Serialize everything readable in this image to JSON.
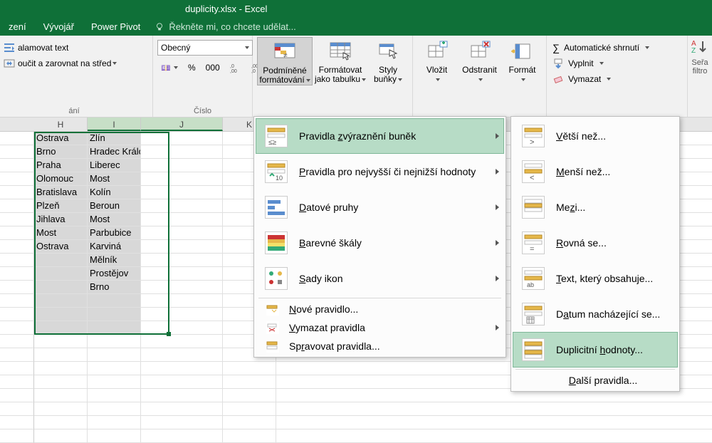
{
  "title": "duplicity.xlsx - Excel",
  "ribbon_tabs": [
    "zení",
    "Vývojář",
    "Power Pivot"
  ],
  "tell_me": "Řekněte mi, co chcete udělat...",
  "alignment": {
    "wrap": "alamovat text",
    "merge": "oučit a zarovnat na střed",
    "group_label": "ání"
  },
  "number": {
    "format": "Obecný",
    "group_label": "Číslo"
  },
  "styles": {
    "cond_fmt_line1": "Podmíněné",
    "cond_fmt_line2": "formátování",
    "fmt_table_line1": "Formátovat",
    "fmt_table_line2": "jako tabulku",
    "cell_styles_line1": "Styly",
    "cell_styles_line2": "buňky"
  },
  "cells_group": {
    "insert": "Vložit",
    "delete": "Odstranit",
    "format": "Formát"
  },
  "editing": {
    "autosum": "Automatické shrnutí",
    "fill": "Vyplnit",
    "clear": "Vymazat"
  },
  "sort_hint_line1": "Seřa",
  "sort_hint_line2": "filtro",
  "columns": [
    "H",
    "I",
    "J",
    "K"
  ],
  "sel_cols": [
    "I",
    "J"
  ],
  "grid": [
    [
      "Ostrava",
      "Zlín"
    ],
    [
      "Brno",
      "Hradec Králové"
    ],
    [
      "Praha",
      "Liberec"
    ],
    [
      "Olomouc",
      "Most"
    ],
    [
      "Bratislava",
      "Kolín"
    ],
    [
      "Plzeň",
      "Beroun"
    ],
    [
      "Jihlava",
      "Most"
    ],
    [
      "Most",
      "Parbubice"
    ],
    [
      "Ostrava",
      "Karviná"
    ],
    [
      "",
      "Mělník"
    ],
    [
      "",
      "Prostějov"
    ],
    [
      "",
      "Brno"
    ]
  ],
  "empty_rows_after": 3,
  "menu1": {
    "highlight": "Pravidla zvýraznění buněk",
    "top_bottom": "Pravidla pro nejvyšší či nejnižší hodnoty",
    "data_bars": "Datové pruhy",
    "color_scales": "Barevné škály",
    "icon_sets": "Sady ikon",
    "new_rule": "Nové pravidlo...",
    "clear_rules": "Vymazat pravidla",
    "manage": "Spravovat pravidla..."
  },
  "menu2": {
    "greater": "Větší než...",
    "less": "Menší než...",
    "between": "Mezi...",
    "equal": "Rovná se...",
    "text_contains": "Text, který obsahuje...",
    "date_occurring": "Datum nacházející se...",
    "duplicates": "Duplicitní hodnoty...",
    "more_rules": "Další pravidla..."
  },
  "chart_data": null
}
